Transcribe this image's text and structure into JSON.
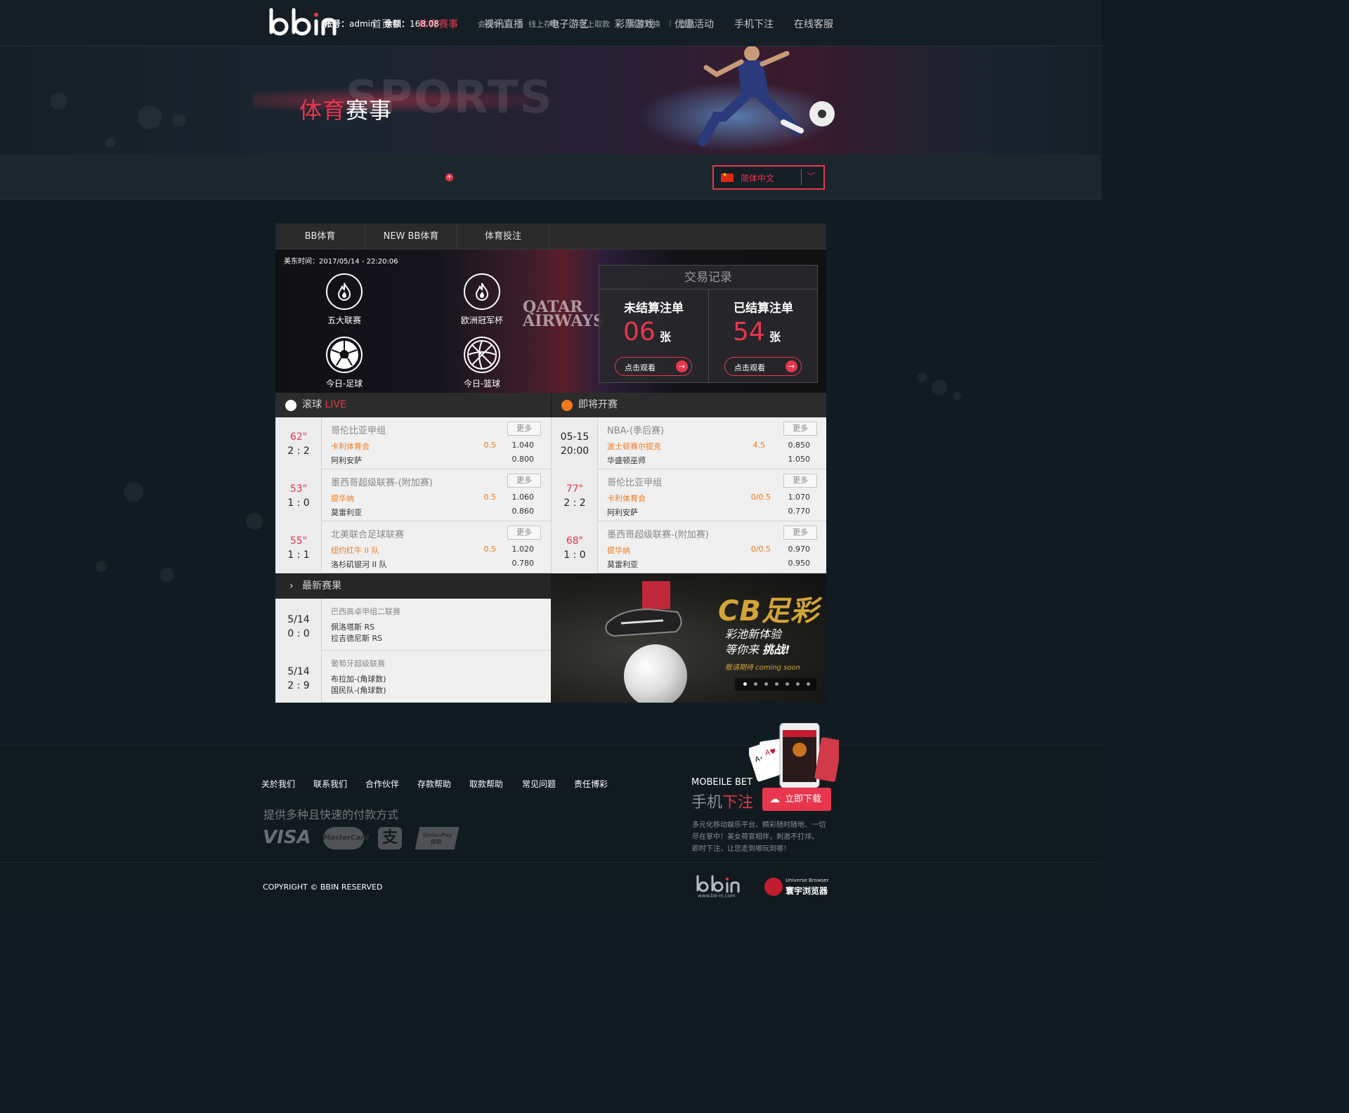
{
  "nav": {
    "items": [
      "首页",
      "体育赛事",
      "视讯直播",
      "电子游艺",
      "彩票游戏",
      "优惠活动",
      "手机下注",
      "在线客服"
    ],
    "active_index": 1
  },
  "banner": {
    "title_red": "体育",
    "title_white": "赛事",
    "ghost_text": "SPORTS"
  },
  "account": {
    "user_label": "帐号：",
    "user": "admin",
    "balance_label": "余额：",
    "balance": "168.08",
    "links": [
      "会员中心",
      "线上存款",
      "线上取款",
      "额度转换",
      "登出"
    ],
    "separator": "|",
    "language": "简体中文",
    "flag_icon": "china-flag-icon"
  },
  "tabs": [
    "BB体育",
    "NEW BB体育",
    "体育投注"
  ],
  "hero": {
    "time": "美东时间：2017/05/14 - 22:20:06",
    "categories": [
      {
        "label": "五大联赛",
        "icon": "flame-icon"
      },
      {
        "label": "欧洲冠军杯",
        "icon": "flame-icon"
      },
      {
        "label": "今日-足球",
        "icon": "soccer-ball-icon"
      },
      {
        "label": "今日-篮球",
        "icon": "basketball-icon"
      }
    ],
    "sponsor": "QATAR AIRWAYS"
  },
  "trade": {
    "title": "交易记录",
    "unsettled": {
      "label": "未结算注单",
      "count": "06",
      "unit": "张",
      "button": "点击观看"
    },
    "settled": {
      "label": "已结算注单",
      "count": "54",
      "unit": "张",
      "button": "点击观看"
    }
  },
  "live": {
    "title": "滚球",
    "live_tag": "LIVE",
    "more": "更多",
    "matches": [
      {
        "time": "62\"",
        "score": "2 : 2",
        "league": "哥伦比亚甲组",
        "home": "卡利体育会",
        "away": "阿利安萨",
        "handicap": "0.5",
        "odds_home": "1.040",
        "odds_away": "0.800"
      },
      {
        "time": "53\"",
        "score": "1 : 0",
        "league": "墨西哥超级联赛-(附加赛)",
        "home": "提华纳",
        "away": "莫雷利亚",
        "handicap": "0.5",
        "odds_home": "1.060",
        "odds_away": "0.860"
      },
      {
        "time": "55\"",
        "score": "1 : 1",
        "league": "北美联合足球联赛",
        "home": "纽约红牛 II 队",
        "away": "洛杉矶银河 II 队",
        "handicap": "0.5",
        "odds_home": "1.020",
        "odds_away": "0.780"
      }
    ]
  },
  "upcoming": {
    "title": "即将开赛",
    "more": "更多",
    "matches": [
      {
        "time": "05-15",
        "score": "20:00",
        "league": "NBA-(季后赛)",
        "home": "波士顿赛尔提克",
        "away": "华盛顿巫师",
        "handicap": "4.5",
        "odds_home": "0.850",
        "odds_away": "1.050"
      },
      {
        "time": "77\"",
        "score": "2 : 2",
        "league": "哥伦比亚甲组",
        "home": "卡利体育会",
        "away": "阿利安萨",
        "handicap": "0/0.5",
        "odds_home": "1.070",
        "odds_away": "0.770"
      },
      {
        "time": "68\"",
        "score": "1 : 0",
        "league": "墨西哥超级联赛-(附加赛)",
        "home": "提华纳",
        "away": "莫雷利亚",
        "handicap": "0/0.5",
        "odds_home": "0.970",
        "odds_away": "0.950"
      }
    ]
  },
  "results": {
    "title": "最新赛果",
    "rows": [
      {
        "date": "5/14",
        "score": "0 : 0",
        "league": "巴西高卓甲组二联赛",
        "team1": "佩洛塔斯 RS",
        "team2": "拉吉德尼斯 RS"
      },
      {
        "date": "5/14",
        "score": "2 : 9",
        "league": "葡萄牙超级联赛",
        "team1": "布拉加-(角球数)",
        "team2": "国民队-(角球数)"
      }
    ]
  },
  "promo": {
    "title": "CB足彩",
    "line1": "彩池新体验",
    "line2a": "等你来",
    "line2b": "挑战!",
    "line3": "敬请期待 coming soon",
    "dots": 7,
    "active_dot": 0
  },
  "footer": {
    "links": [
      "关於我们",
      "联系我们",
      "合作伙伴",
      "存款帮助",
      "取款帮助",
      "常见问题",
      "责任博彩"
    ],
    "payment_title": "提供多种且快速的付款方式",
    "payments": [
      "VISA",
      "MasterCard",
      "支",
      "UnionPay 银联"
    ],
    "copyright": "COPYRIGHT © BBIN RESERVED",
    "mobile_en": "MOBEILE BET",
    "mobile_cn_grey": "手机",
    "mobile_cn_red": "下注",
    "download": "立即下载",
    "desc": [
      "多元化移动娱乐平台、精彩随时随地、一切",
      "尽在掌中！美女荷官相伴，刺激不打烊。",
      "即时下注，让您走到哪玩到哪！"
    ],
    "logo_url": "www.bb-in.com",
    "browser_en": "Universe Browser",
    "browser_cn": "寰宇浏览器"
  },
  "colors": {
    "accent": "#e8364e",
    "orange": "#f07a1e",
    "gold": "#d4a437"
  }
}
